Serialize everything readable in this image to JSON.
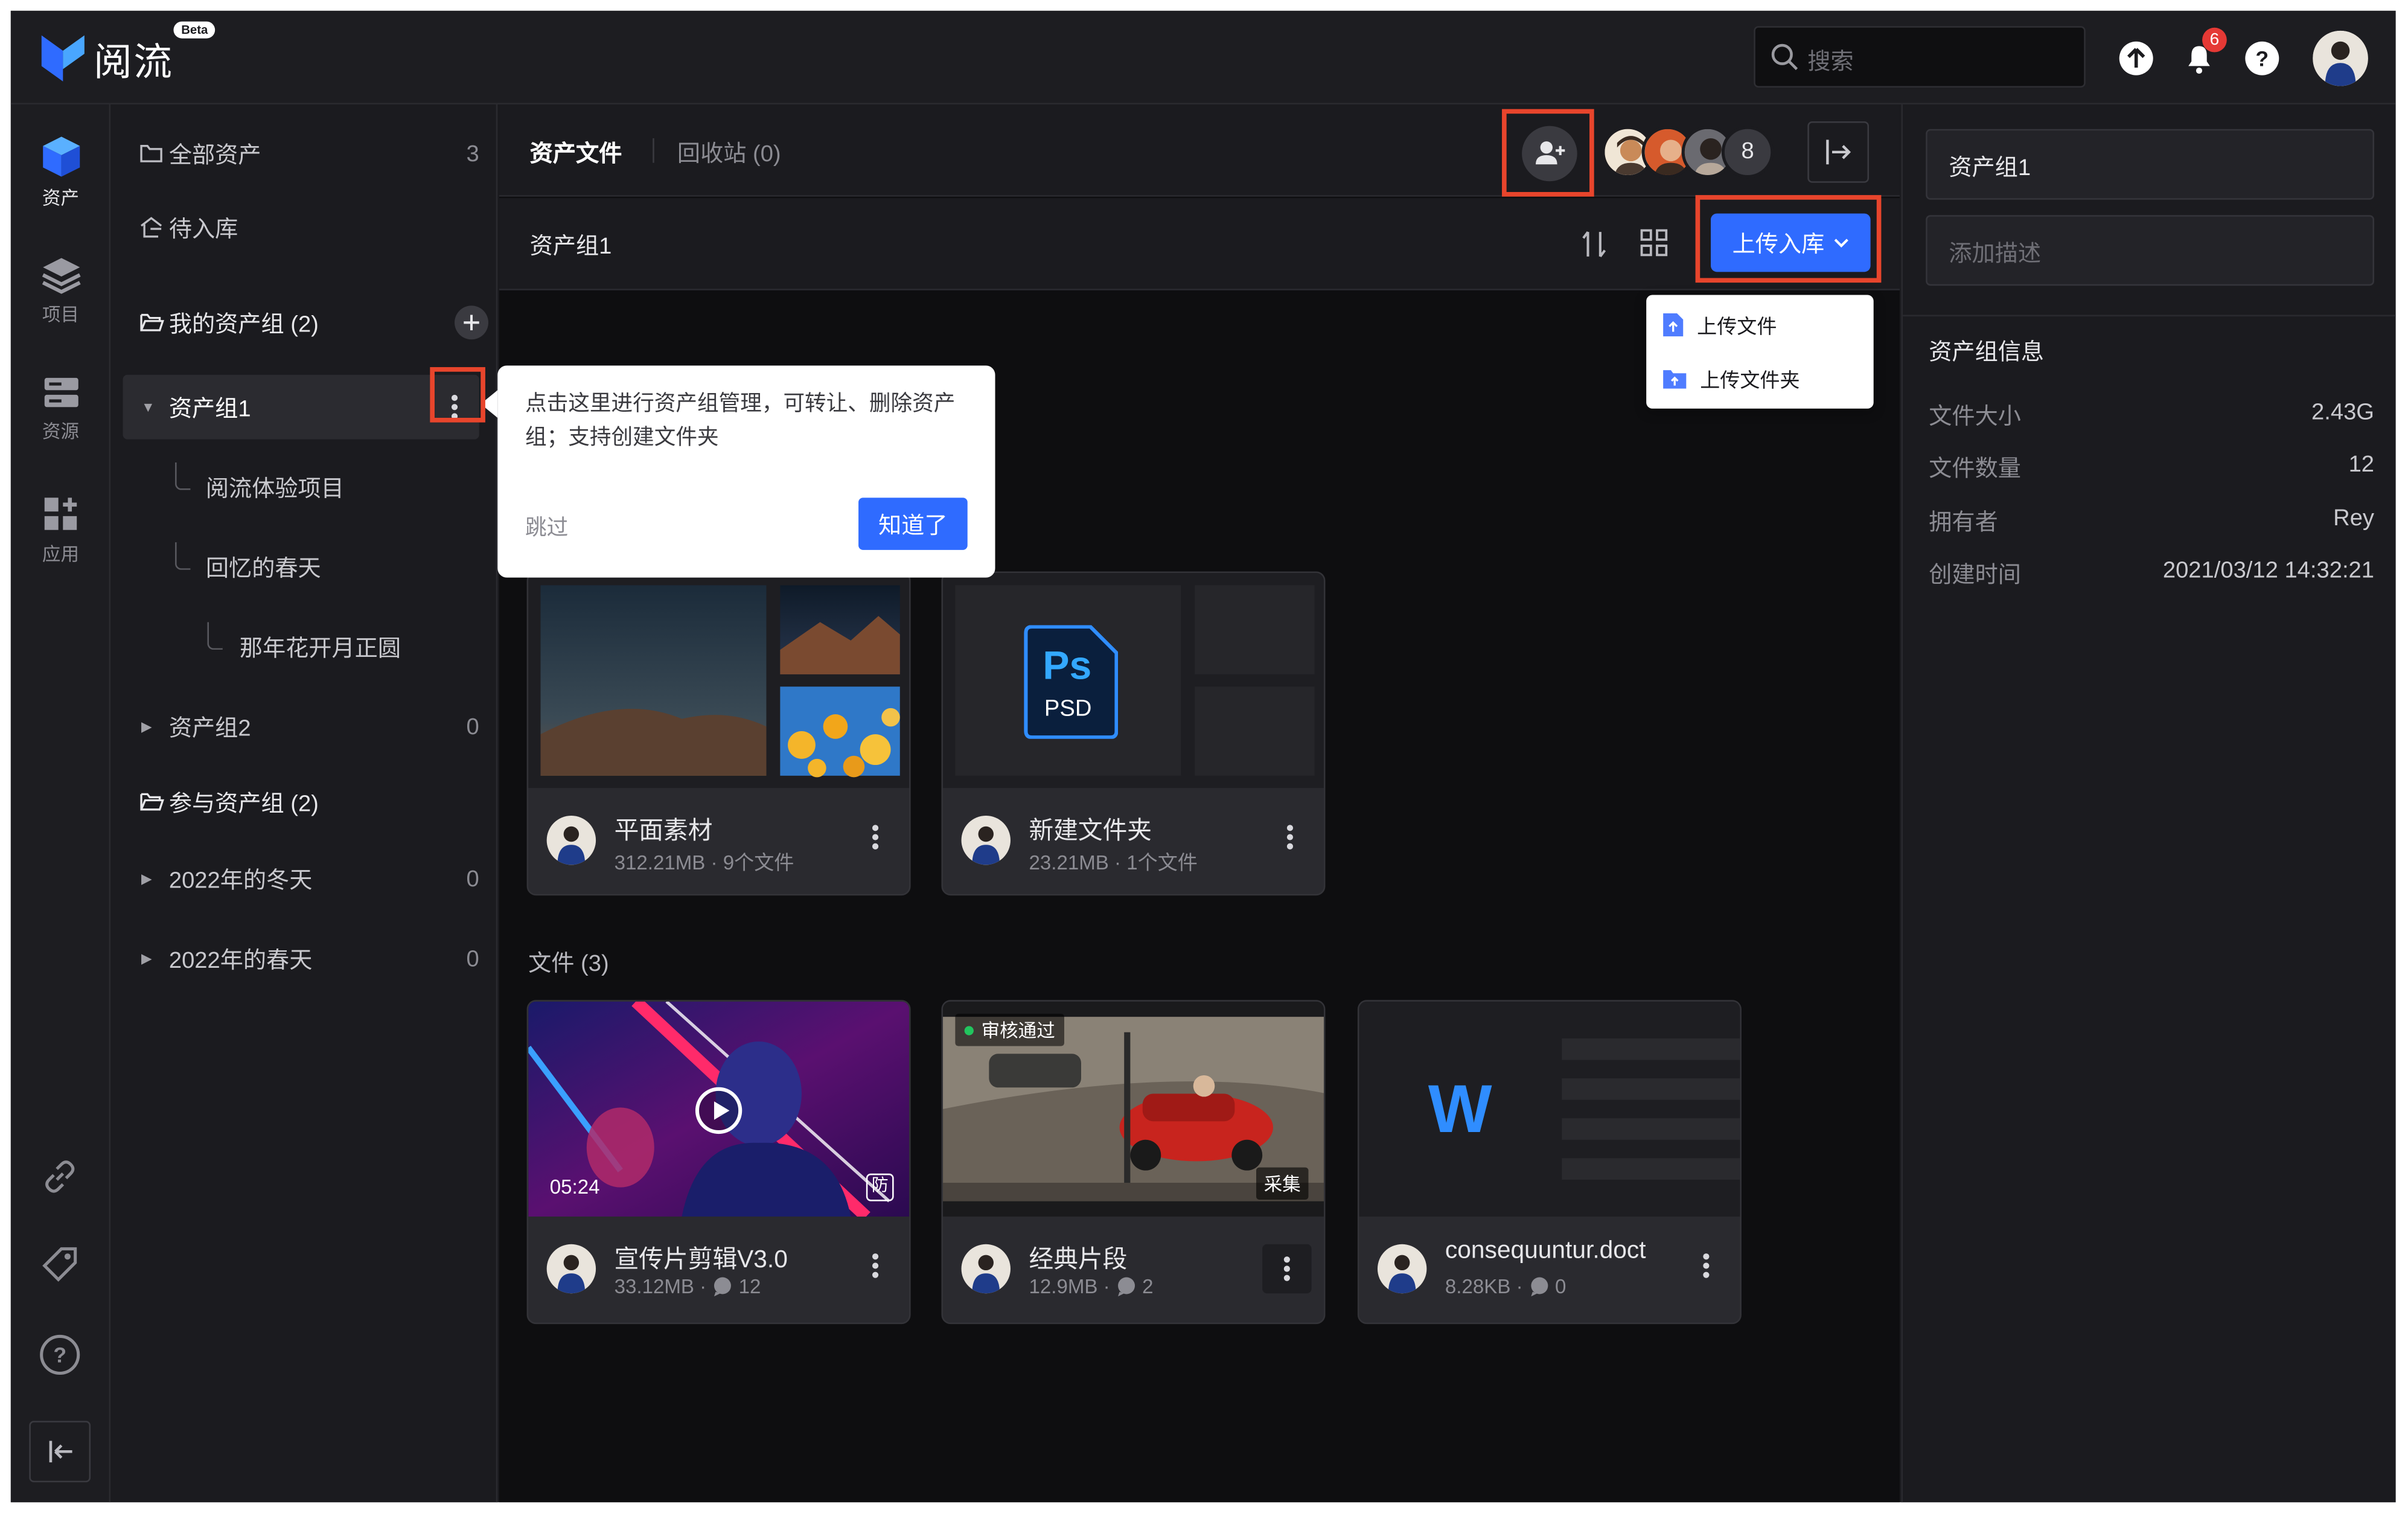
{
  "app": {
    "name": "阅流",
    "badge": "Beta"
  },
  "topbar": {
    "search_placeholder": "搜索",
    "notification_count": "6"
  },
  "rail": {
    "items": [
      {
        "label": "资产",
        "icon": "cube-icon"
      },
      {
        "label": "项目",
        "icon": "layers-icon"
      },
      {
        "label": "资源",
        "icon": "server-icon"
      },
      {
        "label": "应用",
        "icon": "apps-grid-icon"
      }
    ],
    "bottom_icons": [
      "link-icon",
      "tag-icon",
      "help-circle-icon",
      "collapse-sidebar-icon"
    ]
  },
  "tree": {
    "all_assets": {
      "label": "全部资产",
      "count": "3"
    },
    "pending": {
      "label": "待入库"
    },
    "my_groups": {
      "label": "我的资产组 (2)"
    },
    "group1": {
      "label": "资产组1"
    },
    "sub1": {
      "label": "阅流体验项目"
    },
    "sub2": {
      "label": "回忆的春天"
    },
    "sub3": {
      "label": "那年花开月正圆"
    },
    "group2": {
      "label": "资产组2",
      "count": "0"
    },
    "joined_groups": {
      "label": "参与资产组 (2)"
    },
    "winter": {
      "label": "2022年的冬天",
      "count": "0"
    },
    "spring": {
      "label": "2022年的春天",
      "count": "0"
    }
  },
  "main": {
    "tabs": [
      {
        "label": "资产文件"
      },
      {
        "label": "回收站 (0)"
      }
    ],
    "member_count": "8",
    "breadcrumb": "资产组1",
    "upload_label": "上传入库",
    "dropdown": [
      {
        "label": "上传文件"
      },
      {
        "label": "上传文件夹"
      }
    ],
    "files_heading": "文件 (3)"
  },
  "tooltip": {
    "text": "点击这里进行资产组管理，可转让、删除资产组；支持创建文件夹",
    "skip": "跳过",
    "ok": "知道了"
  },
  "folders": [
    {
      "title": "平面素材",
      "meta": "312.21MB · 9个文件"
    },
    {
      "title": "新建文件夹",
      "meta": "23.21MB · 1个文件",
      "ps_label": "Ps",
      "psd_label": "PSD"
    }
  ],
  "files": [
    {
      "title": "宣传片剪辑V3.0",
      "size": "33.12MB ·",
      "comments": "12",
      "duration": "05:24",
      "tag": "防"
    },
    {
      "title": "经典片段",
      "size": "12.9MB ·",
      "comments": "2",
      "status": "审核通过",
      "tag": "采集"
    },
    {
      "title": "consequuntur.doct",
      "size": "8.28KB ·",
      "comments": "0",
      "doc_letter": "W"
    }
  ],
  "right_panel": {
    "name_value": "资产组1",
    "desc_placeholder": "添加描述",
    "info_title": "资产组信息",
    "info": [
      {
        "key": "文件大小",
        "value": "2.43G"
      },
      {
        "key": "文件数量",
        "value": "12"
      },
      {
        "key": "拥有者",
        "value": "Rey"
      },
      {
        "key": "创建时间",
        "value": "2021/03/12 14:32:21"
      }
    ]
  },
  "colors": {
    "accent": "#2f6bff",
    "highlight": "#e8452c",
    "status_green": "#22c55e",
    "badge_red": "#e53935"
  }
}
